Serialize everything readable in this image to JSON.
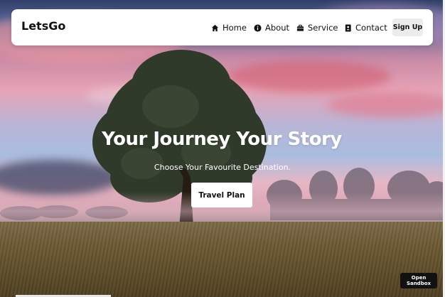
{
  "navbar": {
    "brand": "LetsGo",
    "items": [
      {
        "label": "Home",
        "icon": "home-icon"
      },
      {
        "label": "About",
        "icon": "info-icon"
      },
      {
        "label": "Service",
        "icon": "briefcase-icon"
      },
      {
        "label": "Contact",
        "icon": "contact-book-icon"
      }
    ],
    "signup_label": "Sign Up"
  },
  "hero": {
    "title": "Your Journey Your Story",
    "subtitle": "Choose Your Favourite Destination.",
    "cta_label": "Travel Plan"
  },
  "sandbox_label": "Open Sandbox",
  "colors": {
    "navbar_bg": "#ffffff",
    "text_dark": "#111111",
    "signup_bg": "#ececec",
    "sandbox_bg": "#111111"
  }
}
